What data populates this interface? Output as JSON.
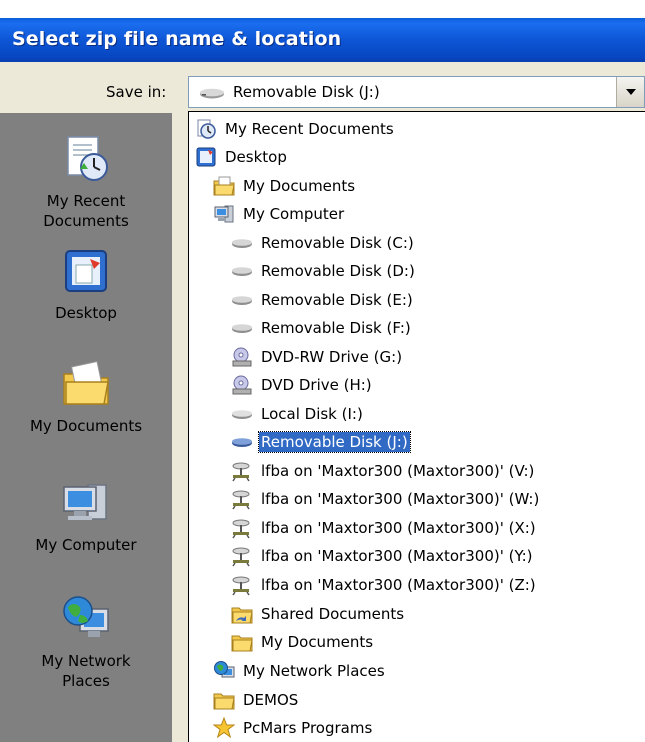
{
  "dialog": {
    "title": "Select zip file name & location"
  },
  "save_in": {
    "label": "Save in:",
    "selected": "Removable Disk (J:)"
  },
  "places_bar": [
    {
      "label_line1": "My Recent",
      "label_line2": "Documents",
      "icon": "recent-documents-icon"
    },
    {
      "label_line1": "Desktop",
      "label_line2": "",
      "icon": "desktop-icon"
    },
    {
      "label_line1": "My Documents",
      "label_line2": "",
      "icon": "my-documents-icon"
    },
    {
      "label_line1": "My Computer",
      "label_line2": "",
      "icon": "my-computer-icon"
    },
    {
      "label_line1": "My Network",
      "label_line2": "Places",
      "icon": "network-places-icon"
    }
  ],
  "dropdown_items": [
    {
      "label": "My Recent Documents",
      "icon": "recent-icon",
      "level": 0
    },
    {
      "label": "Desktop",
      "icon": "desktop-icon",
      "level": 0
    },
    {
      "label": "My Documents",
      "icon": "folder-docs-icon",
      "level": 1
    },
    {
      "label": "My Computer",
      "icon": "computer-icon",
      "level": 1
    },
    {
      "label": "Removable Disk (C:)",
      "icon": "drive-icon",
      "level": 2
    },
    {
      "label": "Removable Disk (D:)",
      "icon": "drive-icon",
      "level": 2
    },
    {
      "label": "Removable Disk (E:)",
      "icon": "drive-icon",
      "level": 2
    },
    {
      "label": "Removable Disk (F:)",
      "icon": "drive-icon",
      "level": 2
    },
    {
      "label": "DVD-RW Drive (G:)",
      "icon": "dvd-icon",
      "level": 2
    },
    {
      "label": "DVD Drive (H:)",
      "icon": "dvd-icon",
      "level": 2
    },
    {
      "label": "Local Disk (I:)",
      "icon": "drive-icon",
      "level": 2
    },
    {
      "label": "Removable Disk (J:)",
      "icon": "drive-icon",
      "level": 2,
      "selected": true
    },
    {
      "label": "lfba on 'Maxtor300 (Maxtor300)' (V:)",
      "icon": "network-drive-icon",
      "level": 2
    },
    {
      "label": "lfba on 'Maxtor300 (Maxtor300)' (W:)",
      "icon": "network-drive-icon",
      "level": 2
    },
    {
      "label": "lfba on 'Maxtor300 (Maxtor300)' (X:)",
      "icon": "network-drive-icon",
      "level": 2
    },
    {
      "label": "lfba on 'Maxtor300 (Maxtor300)' (Y:)",
      "icon": "network-drive-icon",
      "level": 2
    },
    {
      "label": "lfba on 'Maxtor300 (Maxtor300)' (Z:)",
      "icon": "network-drive-icon",
      "level": 2
    },
    {
      "label": "Shared Documents",
      "icon": "shared-folder-icon",
      "level": 2
    },
    {
      "label": "My Documents",
      "icon": "folder-icon",
      "level": 2
    },
    {
      "label": "My Network Places",
      "icon": "network-icon",
      "level": 1
    },
    {
      "label": "DEMOS",
      "icon": "folder-icon",
      "level": 1
    },
    {
      "label": "PcMars Programs",
      "icon": "star-icon",
      "level": 1
    }
  ],
  "colors": {
    "title_bar": "#0a5fd8",
    "places_bar": "#808080",
    "selection": "#316ac5"
  }
}
